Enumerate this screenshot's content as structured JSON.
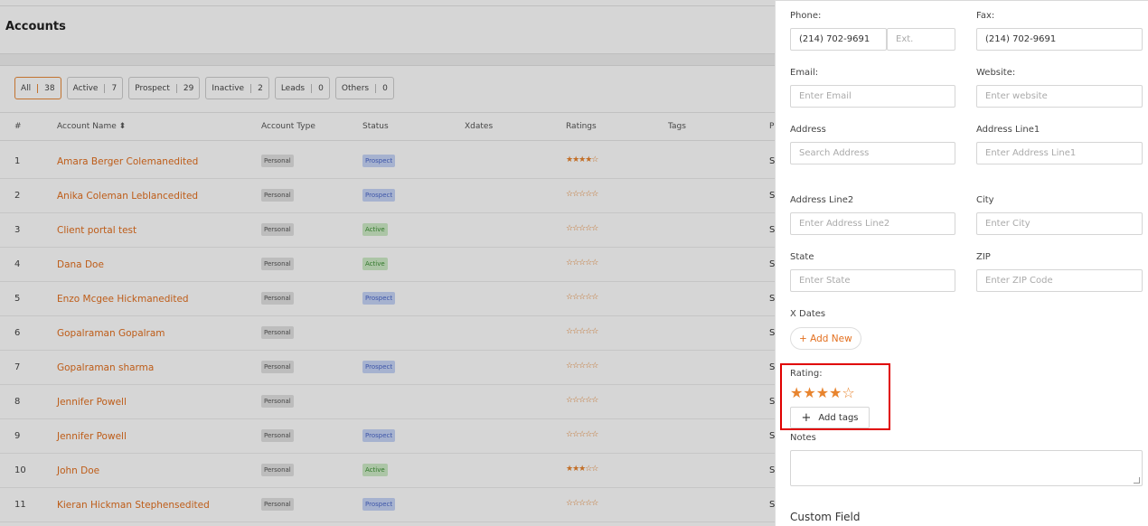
{
  "page": {
    "title": "Accounts",
    "filters": [
      {
        "label": "All",
        "count": "38"
      },
      {
        "label": "Active",
        "count": "7"
      },
      {
        "label": "Prospect",
        "count": "29"
      },
      {
        "label": "Inactive",
        "count": "2"
      },
      {
        "label": "Leads",
        "count": "0"
      },
      {
        "label": "Others",
        "count": "0"
      }
    ],
    "columns": {
      "num": "#",
      "name": "Account Name ⬍",
      "type": "Account Type",
      "status": "Status",
      "xdates": "Xdates",
      "ratings": "Ratings",
      "tags": "Tags",
      "trail": "P"
    },
    "rows": [
      {
        "num": "1",
        "name": "Amara Berger Colemanedited",
        "type": "Personal",
        "status": "Prospect",
        "stars": "★★★★☆",
        "trail": "S"
      },
      {
        "num": "2",
        "name": "Anika Coleman Leblancedited",
        "type": "Personal",
        "status": "Prospect",
        "stars": "☆☆☆☆☆",
        "trail": "S"
      },
      {
        "num": "3",
        "name": "Client portal test",
        "type": "Personal",
        "status": "Active",
        "stars": "☆☆☆☆☆",
        "trail": "S"
      },
      {
        "num": "4",
        "name": "Dana Doe",
        "type": "Personal",
        "status": "Active",
        "stars": "☆☆☆☆☆",
        "trail": "S"
      },
      {
        "num": "5",
        "name": "Enzo Mcgee Hickmanedited",
        "type": "Personal",
        "status": "Prospect",
        "stars": "☆☆☆☆☆",
        "trail": "S"
      },
      {
        "num": "6",
        "name": "Gopalraman Gopalram",
        "type": "Personal",
        "status": "",
        "stars": "☆☆☆☆☆",
        "trail": "S"
      },
      {
        "num": "7",
        "name": "Gopalraman sharma",
        "type": "Personal",
        "status": "Prospect",
        "stars": "☆☆☆☆☆",
        "trail": "S"
      },
      {
        "num": "8",
        "name": "Jennifer Powell",
        "type": "Personal",
        "status": "",
        "stars": "☆☆☆☆☆",
        "trail": "S"
      },
      {
        "num": "9",
        "name": "Jennifer Powell",
        "type": "Personal",
        "status": "Prospect",
        "stars": "☆☆☆☆☆",
        "trail": "S"
      },
      {
        "num": "10",
        "name": "John Doe",
        "type": "Personal",
        "status": "Active",
        "stars": "★★★☆☆",
        "trail": "S"
      },
      {
        "num": "11",
        "name": "Kieran Hickman Stephensedited",
        "type": "Personal",
        "status": "Prospect",
        "stars": "☆☆☆☆☆",
        "trail": "S"
      }
    ]
  },
  "drawer": {
    "phone_label": "Phone:",
    "phone_value": "(214) 702-9691",
    "ext_placeholder": "Ext.",
    "fax_label": "Fax:",
    "fax_value": "(214) 702-9691",
    "email_label": "Email:",
    "email_placeholder": "Enter Email",
    "website_label": "Website:",
    "website_placeholder": "Enter website",
    "address_label": "Address",
    "address_placeholder": "Search Address",
    "address1_label": "Address Line1",
    "address1_placeholder": "Enter Address Line1",
    "address2_label": "Address Line2",
    "address2_placeholder": "Enter Address Line2",
    "city_label": "City",
    "city_placeholder": "Enter City",
    "state_label": "State",
    "state_placeholder": "Enter State",
    "zip_label": "ZIP",
    "zip_placeholder": "Enter ZIP Code",
    "xdates_label": "X Dates",
    "add_new_label": "+ Add New",
    "rating_label": "Rating:",
    "rating_stars": "★★★★☆",
    "rating_value": 4,
    "rating_max": 5,
    "add_tags_label": "Add tags",
    "notes_label": "Notes",
    "custom_field_label": "Custom Field"
  },
  "colors": {
    "accent": "#e36f1e",
    "star": "#e8842e",
    "highlight": "#e00000"
  }
}
